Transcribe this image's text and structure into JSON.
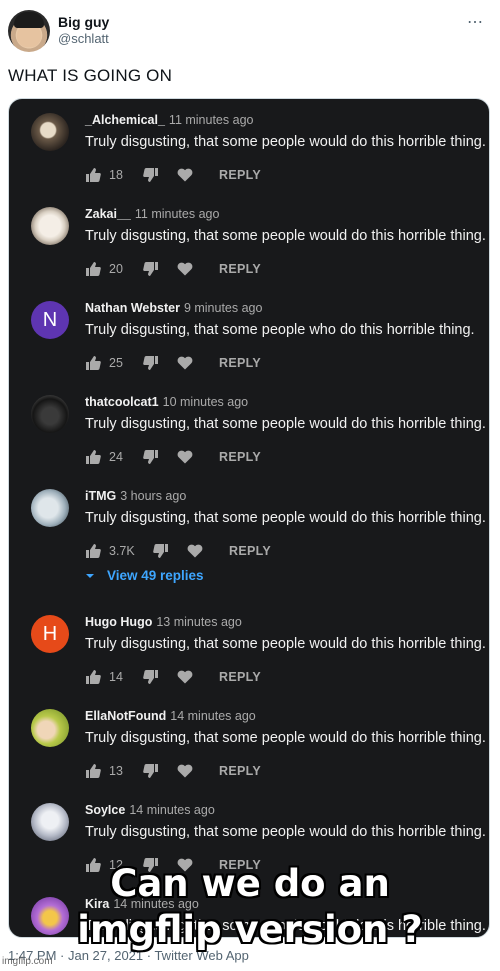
{
  "tweet": {
    "display_name": "Big guy",
    "handle": "@schlatt",
    "text": "WHAT IS GOING ON",
    "footer": "1:47 PM · Jan 27, 2021 · Twitter Web App"
  },
  "comments": [
    {
      "author": "_Alchemical_",
      "time": "11 minutes ago",
      "text": "Truly disgusting, that some people would do this horrible thing.",
      "likes": "18",
      "reply": "REPLY"
    },
    {
      "author": "Zakai__",
      "time": "11 minutes ago",
      "text": "Truly disgusting, that some people would do this horrible thing.",
      "likes": "20",
      "reply": "REPLY"
    },
    {
      "author": "Nathan Webster",
      "time": "9 minutes ago",
      "text": "Truly disgusting, that some people who do this horrible thing.",
      "likes": "25",
      "reply": "REPLY",
      "avatar_letter": "N",
      "avatar_color": "#5e35b1"
    },
    {
      "author": "thatcoolcat1",
      "time": "10 minutes ago",
      "text": "Truly disgusting, that some people would do this horrible thing.",
      "likes": "24",
      "reply": "REPLY"
    },
    {
      "author": "iTMG",
      "time": "3 hours ago",
      "text": "Truly disgusting, that some people would do this horrible thing.",
      "likes": "3.7K",
      "reply": "REPLY"
    },
    {
      "author": "Hugo Hugo",
      "time": "13 minutes ago",
      "text": "Truly disgusting, that some people would do this horrible thing.",
      "likes": "14",
      "reply": "REPLY",
      "avatar_letter": "H",
      "avatar_color": "#e64a19"
    },
    {
      "author": "EllaNotFound",
      "time": "14 minutes ago",
      "text": "Truly disgusting, that some people would do this horrible thing.",
      "likes": "13",
      "reply": "REPLY"
    },
    {
      "author": "SoyIce",
      "time": "14 minutes ago",
      "text": "Truly disgusting, that some people would do this horrible thing.",
      "likes": "12",
      "reply": "REPLY"
    },
    {
      "author": "Kira",
      "time": "14 minutes ago",
      "text": "Truly disgusting, that some people would do this horrible thing."
    }
  ],
  "view_replies": "View 49 replies",
  "meme_caption": {
    "line1": "Can we do an",
    "line2": "imgflip version ?"
  },
  "watermark": "imgflip.com",
  "colors": {
    "panel_bg": "#18191b",
    "link_blue": "#3ea6ff"
  }
}
